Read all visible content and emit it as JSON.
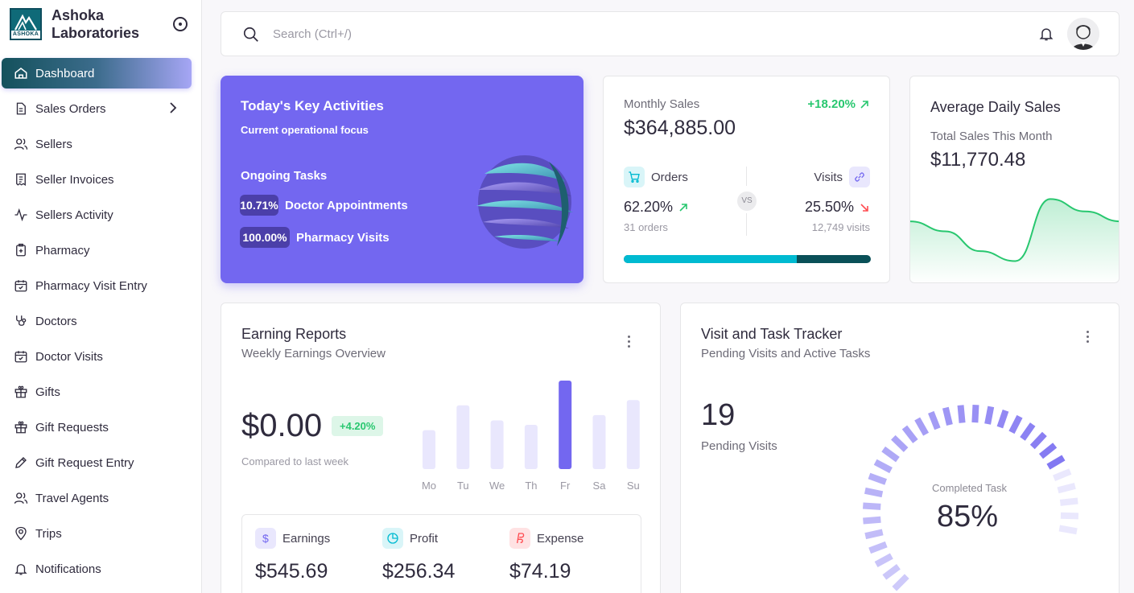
{
  "brand": {
    "name": "Ashoka Laboratories",
    "logo_text": "ASHOKA"
  },
  "sidebar": {
    "items": [
      {
        "label": "Dashboard",
        "icon": "home-icon",
        "active": true
      },
      {
        "label": "Sales Orders",
        "icon": "file-icon",
        "has_submenu": true
      },
      {
        "label": "Sellers",
        "icon": "users-icon"
      },
      {
        "label": "Seller Invoices",
        "icon": "receipt-icon"
      },
      {
        "label": "Sellers Activity",
        "icon": "activity-icon"
      },
      {
        "label": "Pharmacy",
        "icon": "medical-icon"
      },
      {
        "label": "Pharmacy Visit Entry",
        "icon": "calendar-check-icon"
      },
      {
        "label": "Doctors",
        "icon": "stethoscope-icon"
      },
      {
        "label": "Doctor Visits",
        "icon": "calendar-check-icon"
      },
      {
        "label": "Gifts",
        "icon": "gift-icon"
      },
      {
        "label": "Gift Requests",
        "icon": "gift-icon"
      },
      {
        "label": "Gift Request Entry",
        "icon": "pencil-icon"
      },
      {
        "label": "Travel Agents",
        "icon": "users-icon"
      },
      {
        "label": "Trips",
        "icon": "map-pin-icon"
      },
      {
        "label": "Notifications",
        "icon": "bell-icon"
      }
    ]
  },
  "topbar": {
    "search_placeholder": "Search (Ctrl+/)"
  },
  "key_activities": {
    "title": "Today's Key Activities",
    "subtitle": "Current operational focus",
    "tasks_title": "Ongoing Tasks",
    "tasks": [
      {
        "percent": "10.71%",
        "label": "Doctor Appointments"
      },
      {
        "percent": "100.00%",
        "label": "Pharmacy Visits"
      }
    ]
  },
  "monthly_sales": {
    "title": "Monthly Sales",
    "change": "+18.20%",
    "value": "$364,885.00",
    "orders_label": "Orders",
    "visits_label": "Visits",
    "vs": "VS",
    "orders_pct": "62.20%",
    "orders_sub": "31 orders",
    "visits_pct": "25.50%",
    "visits_sub": "12,749 visits",
    "orders_share": 0.7,
    "colors": {
      "orders": "#00bad1",
      "visits": "#0a5058",
      "up": "#28c76f",
      "down": "#ff4c51"
    }
  },
  "avg_daily_sales": {
    "title": "Average Daily Sales",
    "subtitle": "Total Sales This Month",
    "value": "$11,770.48",
    "trend": [
      44,
      36,
      20,
      12,
      62,
      52,
      44
    ]
  },
  "earning_reports": {
    "title": "Earning Reports",
    "subtitle": "Weekly Earnings Overview",
    "value": "$0.00",
    "change": "+4.20%",
    "compare_text": "Compared to last week",
    "chart_data": {
      "type": "bar",
      "categories": [
        "Mo",
        "Tu",
        "We",
        "Th",
        "Fr",
        "Sa",
        "Su"
      ],
      "values": [
        44,
        72,
        55,
        50,
        100,
        61,
        78
      ],
      "highlight_index": 4,
      "colors": {
        "bar": "#e9e7fd",
        "highlight": "#7367f0"
      }
    },
    "stats": [
      {
        "label": "Earnings",
        "value": "$545.69",
        "icon": "dollar-icon"
      },
      {
        "label": "Profit",
        "value": "$256.34",
        "icon": "pie-chart-icon"
      },
      {
        "label": "Expense",
        "value": "$74.19",
        "icon": "paypal-icon"
      }
    ]
  },
  "visit_tracker": {
    "title": "Visit and Task Tracker",
    "subtitle": "Pending Visits and Active Tasks",
    "pending_count": "19",
    "pending_label": "Pending Visits",
    "gauge_label": "Completed Task",
    "gauge_value": "85%",
    "gauge_fraction": 0.85
  }
}
